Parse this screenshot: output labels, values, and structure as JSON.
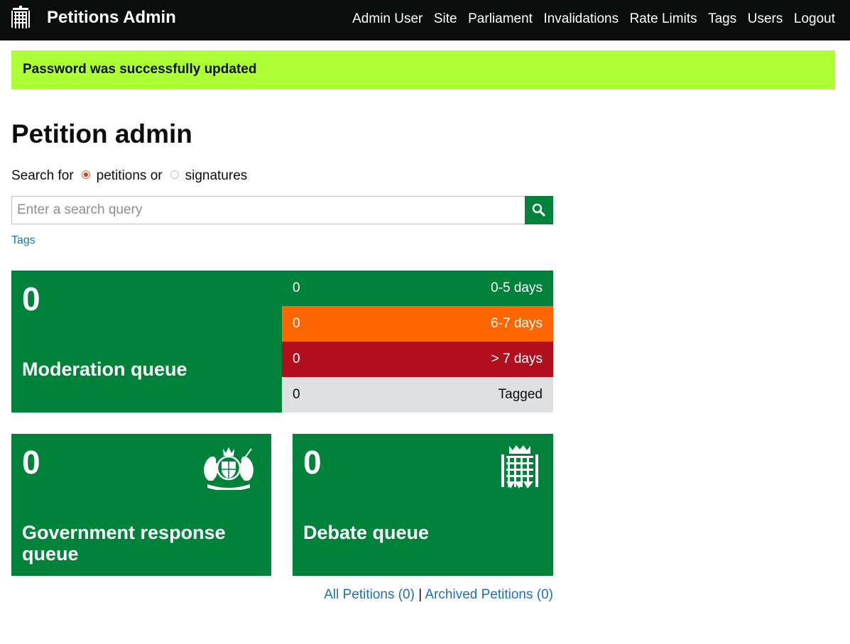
{
  "header": {
    "logo_icon": "portcullis-icon",
    "brand": "Petitions Admin",
    "nav": [
      {
        "label": "Admin User"
      },
      {
        "label": "Site"
      },
      {
        "label": "Parliament"
      },
      {
        "label": "Invalidations"
      },
      {
        "label": "Rate Limits"
      },
      {
        "label": "Tags"
      },
      {
        "label": "Users"
      },
      {
        "label": "Logout"
      }
    ]
  },
  "flash": {
    "message": "Password was successfully updated",
    "color": "#acff33"
  },
  "page": {
    "title": "Petition admin"
  },
  "search": {
    "label": "Search for",
    "option_petitions": "petitions or",
    "option_signatures": "signatures",
    "selected": "petitions",
    "placeholder": "Enter a search query",
    "value": "",
    "button_icon": "search-icon"
  },
  "tags_link": "Tags",
  "moderation": {
    "count": "0",
    "label": "Moderation queue",
    "breakdown": [
      {
        "count": "0",
        "label": "0-5 days",
        "color": "#00823b"
      },
      {
        "count": "0",
        "label": "6-7 days",
        "color": "#ff6600"
      },
      {
        "count": "0",
        "label": "> 7 days",
        "color": "#b10e1e"
      },
      {
        "count": "0",
        "label": "Tagged",
        "color": "#dee0e2"
      }
    ]
  },
  "government_response": {
    "count": "0",
    "label": "Government response queue",
    "icon": "royal-coat-of-arms-icon"
  },
  "debate": {
    "count": "0",
    "label": "Debate queue",
    "icon": "portcullis-icon"
  },
  "footer": {
    "all_petitions": "All Petitions (0)",
    "separator": "|",
    "archived_petitions": "Archived Petitions (0)"
  },
  "colors": {
    "accent_green": "#00823b",
    "header_bg": "#0b0c0c",
    "link": "#1d70b8"
  }
}
